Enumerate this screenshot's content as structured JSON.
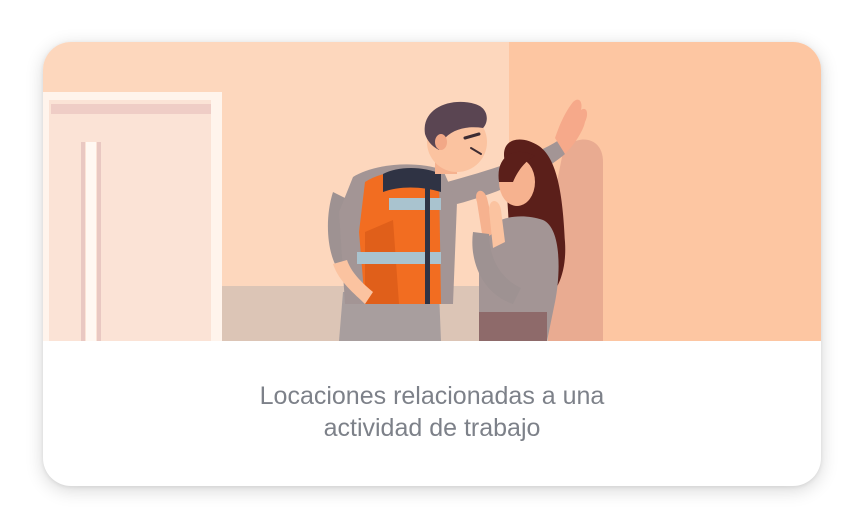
{
  "card": {
    "caption_line1": "Locaciones relacionadas a una",
    "caption_line2": "actividad de trabajo",
    "illustration_icon": "workplace-harassment-illustration"
  },
  "colors": {
    "wall_left": "#fdd7bd",
    "wall_right": "#fdc6a2",
    "floor": "#d9c2b4",
    "caption_text": "#7d8189",
    "vest_orange": "#f26d21",
    "reflective_stripe": "#a9c3cf"
  }
}
